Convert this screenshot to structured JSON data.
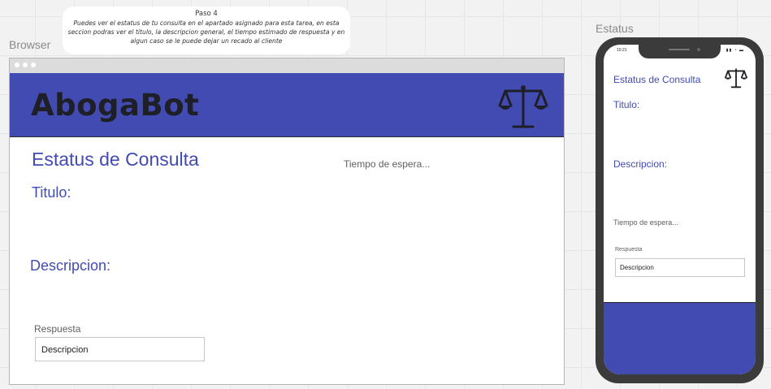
{
  "note": {
    "title": "Paso 4",
    "body": "Puedes ver el estatus de tu consulta en el apartado asignado para esta tarea, en esta seccion podras ver el titulo, la descripcion general, el tiempo estimado de respuesta y en algun caso se le puede dejar un recado al cliente"
  },
  "browser": {
    "frame_label": "Browser",
    "brand": "AbogaBot",
    "brand_icon": "scale-icon",
    "page_title": "Estatus de Consulta",
    "title_label": "Titulo:",
    "description_label": "Descripcion:",
    "wait_label": "Tiempo de espera...",
    "response_label": "Respuesta",
    "response_value": "Descripcion"
  },
  "phone": {
    "frame_label": "Estatus",
    "status_time": "10:21",
    "page_title": "Estatus de Consulta",
    "title_label": "Titulo:",
    "description_label": "Descripcion:",
    "wait_label": "Tiempo de espera...",
    "response_label": "Respuesta",
    "response_value": "Descripcion"
  },
  "colors": {
    "accent": "#414bb2",
    "dark": "#1f1f28"
  }
}
